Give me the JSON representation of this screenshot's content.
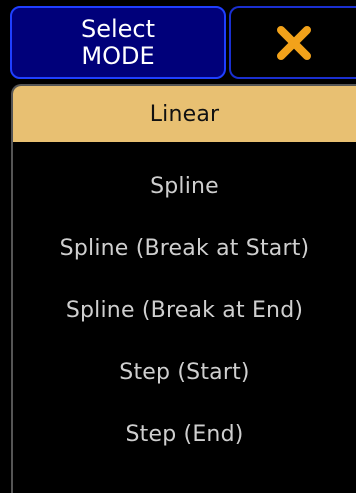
{
  "header": {
    "title_line1": "Select",
    "title_line2": "MODE"
  },
  "close_icon": "close-x-icon",
  "colors": {
    "background": "#000000",
    "header_fill": "#00007a",
    "header_border": "#1f3fff",
    "selected_fill": "#e8c072",
    "close_icon": "#f2a21a",
    "option_text": "#cfcfcf"
  },
  "options": [
    {
      "label": "Linear",
      "selected": true
    },
    {
      "label": "Spline",
      "selected": false
    },
    {
      "label": "Spline (Break at Start)",
      "selected": false
    },
    {
      "label": "Spline (Break at End)",
      "selected": false
    },
    {
      "label": "Step (Start)",
      "selected": false
    },
    {
      "label": "Step (End)",
      "selected": false
    }
  ]
}
